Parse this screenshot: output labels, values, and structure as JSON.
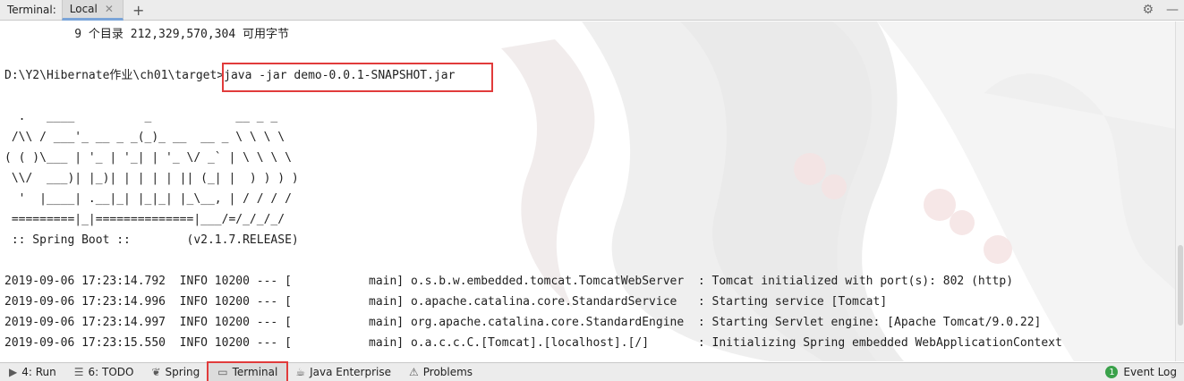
{
  "header": {
    "title": "Terminal:",
    "tab_label": "Local",
    "close_icon": "✕",
    "add_icon": "+",
    "settings_icon": "⚙",
    "minimize_icon": "—"
  },
  "terminal": {
    "lines": [
      "          9 个目录 212,329,570,304 可用字节",
      "D:\\Y2\\Hibernate作业\\ch01\\target>java -jar demo-0.0.1-SNAPSHOT.jar",
      "  .   ____          _            __ _ _",
      " /\\\\ / ___'_ __ _ _(_)_ __  __ _ \\ \\ \\ \\",
      "( ( )\\___ | '_ | '_| | '_ \\/ _` | \\ \\ \\ \\",
      " \\\\/  ___)| |_)| | | | | || (_| |  ) ) ) )",
      "  '  |____| .__|_| |_|_| |_\\__, | / / / /",
      " =========|_|==============|___/=/_/_/_/",
      " :: Spring Boot ::        (v2.1.7.RELEASE)",
      "2019-09-06 17:23:14.792  INFO 10200 --- [           main] o.s.b.w.embedded.tomcat.TomcatWebServer  : Tomcat initialized with port(s): 802 (http)",
      "2019-09-06 17:23:14.996  INFO 10200 --- [           main] o.apache.catalina.core.StandardService   : Starting service [Tomcat]",
      "2019-09-06 17:23:14.997  INFO 10200 --- [           main] org.apache.catalina.core.StandardEngine  : Starting Servlet engine: [Apache Tomcat/9.0.22]",
      "2019-09-06 17:23:15.550  INFO 10200 --- [           main] o.a.c.c.C.[Tomcat].[localhost].[/]       : Initializing Spring embedded WebApplicationContext"
    ]
  },
  "toolbar": {
    "items": [
      {
        "icon": "▶",
        "label": "4: Run"
      },
      {
        "icon": "☰",
        "label": "6: TODO"
      },
      {
        "icon": "❦",
        "label": "Spring"
      },
      {
        "icon": "▭",
        "label": "Terminal"
      },
      {
        "icon": "☕",
        "label": "Java Enterprise"
      },
      {
        "icon": "⚠",
        "label": "Problems"
      }
    ],
    "event_log_label": "Event Log",
    "event_log_count": "1"
  },
  "colors": {
    "highlight": "#e13b3b",
    "accent": "#7aa4d8"
  }
}
